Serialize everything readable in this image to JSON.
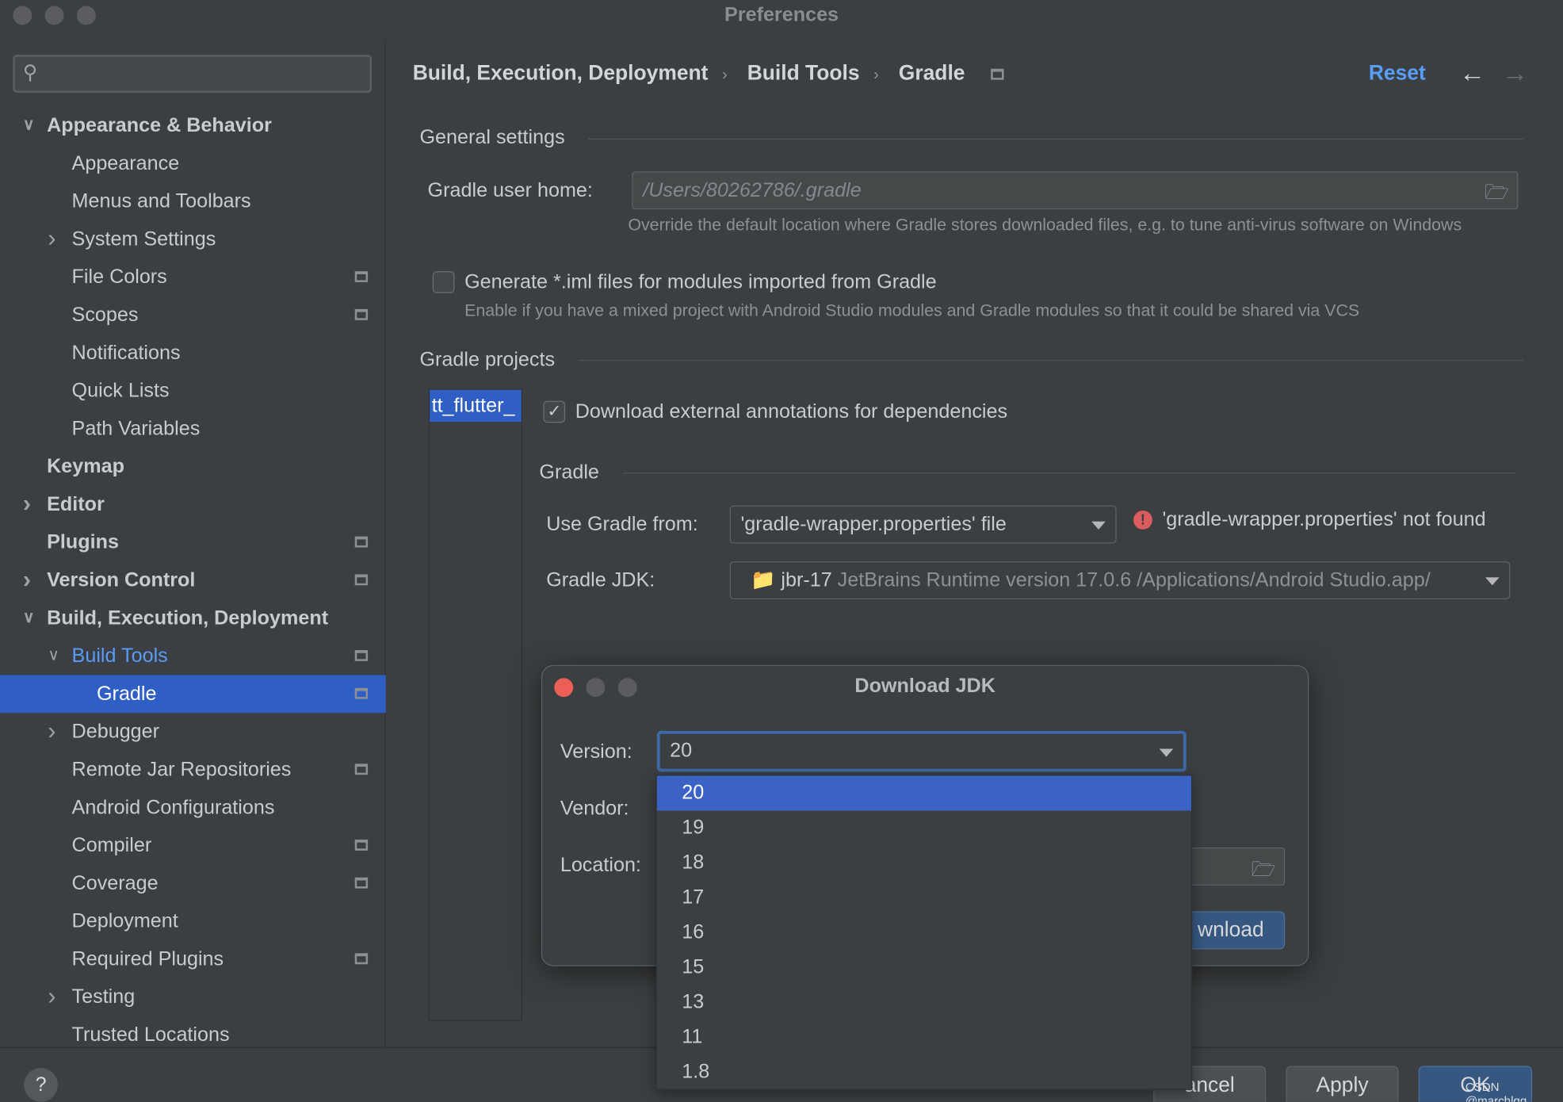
{
  "window": {
    "title": "Preferences"
  },
  "sidebar": {
    "search_placeholder": "",
    "items": [
      {
        "label": "Appearance & Behavior",
        "level": 0,
        "bold": true,
        "chevron": "down"
      },
      {
        "label": "Appearance",
        "level": 1
      },
      {
        "label": "Menus and Toolbars",
        "level": 1
      },
      {
        "label": "System Settings",
        "level": 1,
        "chevron": "right"
      },
      {
        "label": "File Colors",
        "level": 1,
        "project": true
      },
      {
        "label": "Scopes",
        "level": 1,
        "project": true
      },
      {
        "label": "Notifications",
        "level": 1
      },
      {
        "label": "Quick Lists",
        "level": 1
      },
      {
        "label": "Path Variables",
        "level": 1
      },
      {
        "label": "Keymap",
        "level": 0,
        "bold": true
      },
      {
        "label": "Editor",
        "level": 0,
        "bold": true,
        "chevron": "right"
      },
      {
        "label": "Plugins",
        "level": 0,
        "bold": true,
        "project": true
      },
      {
        "label": "Version Control",
        "level": 0,
        "bold": true,
        "chevron": "right",
        "project": true
      },
      {
        "label": "Build, Execution, Deployment",
        "level": 0,
        "bold": true,
        "chevron": "down"
      },
      {
        "label": "Build Tools",
        "level": 1,
        "chevron": "down",
        "project": true,
        "blue": true
      },
      {
        "label": "Gradle",
        "level": 2,
        "project": true,
        "selected": true
      },
      {
        "label": "Debugger",
        "level": 1,
        "chevron": "right"
      },
      {
        "label": "Remote Jar Repositories",
        "level": 1,
        "project": true
      },
      {
        "label": "Android Configurations",
        "level": 1
      },
      {
        "label": "Compiler",
        "level": 1,
        "project": true
      },
      {
        "label": "Coverage",
        "level": 1,
        "project": true
      },
      {
        "label": "Deployment",
        "level": 1
      },
      {
        "label": "Required Plugins",
        "level": 1,
        "project": true
      },
      {
        "label": "Testing",
        "level": 1,
        "chevron": "right"
      },
      {
        "label": "Trusted Locations",
        "level": 1
      }
    ]
  },
  "header": {
    "breadcrumb": [
      "Build, Execution, Deployment",
      "Build Tools",
      "Gradle"
    ],
    "reset": "Reset"
  },
  "general": {
    "title": "General settings",
    "user_home_label": "Gradle user home:",
    "user_home_value": "/Users/80262786/.gradle",
    "user_home_hint": "Override the default location where Gradle stores downloaded files, e.g. to tune anti-virus software on Windows",
    "iml_label": "Generate *.iml files for modules imported from Gradle",
    "iml_checked": false,
    "iml_hint": "Enable if you have a mixed project with Android Studio modules and Gradle modules so that it could be shared via VCS"
  },
  "projects": {
    "title": "Gradle projects",
    "list": [
      "tt_flutter_"
    ],
    "annotations_label": "Download external annotations for dependencies",
    "annotations_checked": true,
    "gradle_title": "Gradle",
    "use_from_label": "Use Gradle from:",
    "use_from_value": "'gradle-wrapper.properties' file",
    "error": "'gradle-wrapper.properties' not found",
    "jdk_label": "Gradle JDK:",
    "jdk_name": "jbr-17",
    "jdk_detail": "JetBrains Runtime version 17.0.6 /Applications/Android Studio.app/"
  },
  "dialog": {
    "title": "Download JDK",
    "version_label": "Version:",
    "version_value": "20",
    "vendor_label": "Vendor:",
    "location_label": "Location:",
    "download_button": "wnload",
    "versions": [
      "20",
      "19",
      "18",
      "17",
      "16",
      "15",
      "13",
      "11",
      "1.8"
    ],
    "selected": "20"
  },
  "footer": {
    "help": "?",
    "cancel": "ancel",
    "apply": "Apply",
    "ok": "OK"
  },
  "watermark": "CSDN @marchlqq",
  "colors": {
    "accent": "#589df6",
    "selection": "#2f5fc4",
    "error": "#db5c5c"
  }
}
